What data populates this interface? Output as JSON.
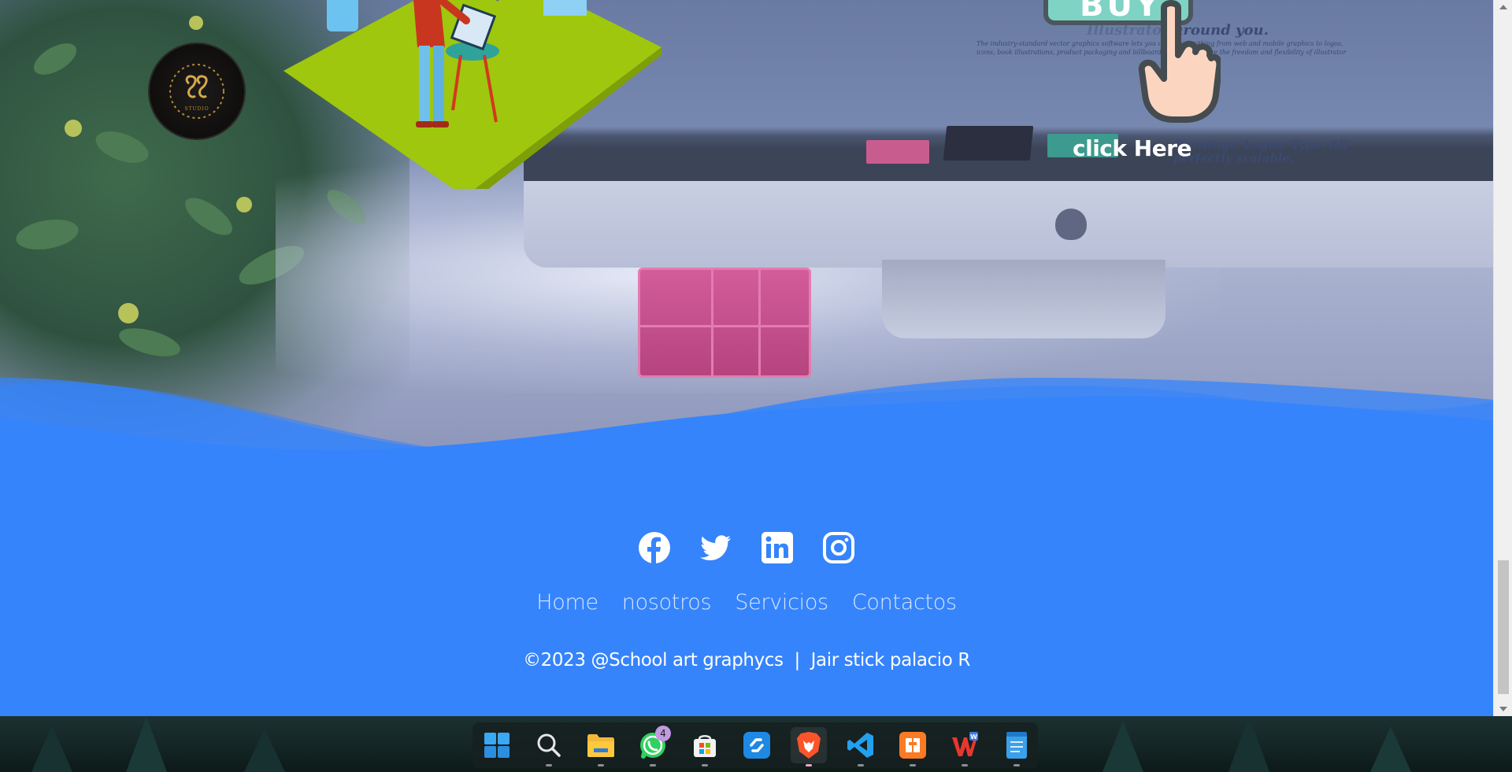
{
  "hero": {
    "click_here": "click Here",
    "screen_heading": "Illustrator",
    "screen_heading_tail": "around you.",
    "screen_heading2": "Drawings. Logos. Type. All\nperfectly scalable.",
    "screen_body": "The industry-standard vector graphics software lets you create everything from web and mobile graphics to logos, icons, book illustrations, product packaging and billboards, and experience the freedom and flexibility of illustrator",
    "buy_label": "BUY"
  },
  "footer": {
    "social": [
      {
        "name": "facebook",
        "icon": "facebook-icon"
      },
      {
        "name": "twitter",
        "icon": "twitter-icon"
      },
      {
        "name": "linkedin",
        "icon": "linkedin-icon"
      },
      {
        "name": "instagram",
        "icon": "instagram-icon"
      }
    ],
    "nav": [
      "Home",
      "nosotros",
      "Servicios",
      "Contactos"
    ],
    "copyright": "©2023 @School art graphycs  |  Jair stick palacio R",
    "background_color": "#3584fc"
  },
  "taskbar": {
    "apps": [
      {
        "name": "start",
        "icon": "windows-start-icon"
      },
      {
        "name": "search",
        "icon": "search-icon"
      },
      {
        "name": "file-explorer",
        "icon": "folder-icon"
      },
      {
        "name": "whatsapp",
        "icon": "whatsapp-icon",
        "badge": "4"
      },
      {
        "name": "microsoft-store",
        "icon": "store-icon"
      },
      {
        "name": "app",
        "icon": "sync-app-icon"
      },
      {
        "name": "brave",
        "icon": "brave-lion-icon"
      },
      {
        "name": "vscode",
        "icon": "vscode-icon"
      },
      {
        "name": "xampp",
        "icon": "xampp-icon"
      },
      {
        "name": "wps-office",
        "icon": "wps-office-icon"
      },
      {
        "name": "notepad",
        "icon": "notepad-icon"
      }
    ]
  }
}
